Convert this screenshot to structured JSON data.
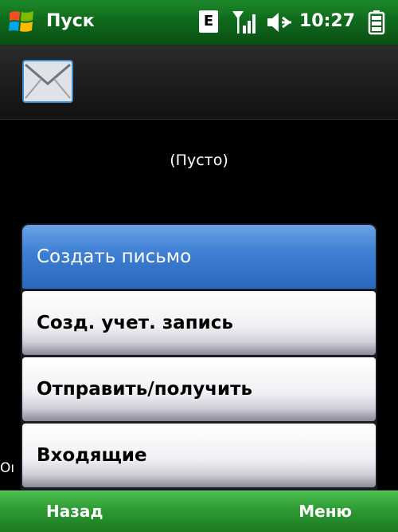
{
  "status_bar": {
    "start_label": "Пуск",
    "network_type": "E",
    "time": "10:27",
    "icons": [
      "windows-start-icon",
      "signal-strength-icon",
      "volume-icon",
      "battery-icon"
    ],
    "colors": {
      "bar": "#0f6a1c"
    }
  },
  "header": {
    "icon": "envelope-icon",
    "colors": {
      "icon_border": "#3b8ed0"
    }
  },
  "content": {
    "empty_text": "(Пусто)",
    "partial_text": "Oı"
  },
  "menu": {
    "items": [
      {
        "label": "Создать письмо",
        "selected": true
      },
      {
        "label": "Созд. учет. запись",
        "selected": false
      },
      {
        "label": "Отправить/получить",
        "selected": false
      },
      {
        "label": "Входящие",
        "selected": false
      }
    ],
    "colors": {
      "selected": "#3d7fd3",
      "item": "#f1f1f5"
    }
  },
  "softkeys": {
    "left": "Назад",
    "right": "Меню",
    "colors": {
      "bar": "#2e9a33"
    }
  }
}
